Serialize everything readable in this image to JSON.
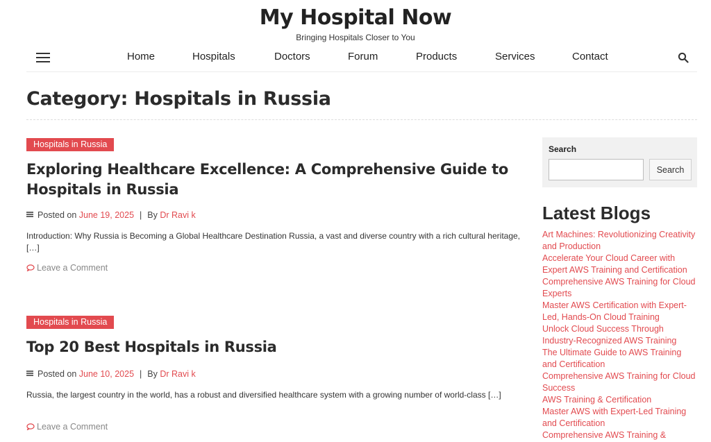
{
  "header": {
    "site_title": "My Hospital Now",
    "tagline": "Bringing Hospitals Closer to You"
  },
  "nav": {
    "items": [
      {
        "label": "Home"
      },
      {
        "label": "Hospitals"
      },
      {
        "label": "Doctors"
      },
      {
        "label": "Forum"
      },
      {
        "label": "Products"
      },
      {
        "label": "Services"
      },
      {
        "label": "Contact"
      }
    ]
  },
  "archive": {
    "title": "Category: Hospitals in Russia"
  },
  "posts": [
    {
      "category": "Hospitals in Russia",
      "title": "Exploring Healthcare Excellence: A Comprehensive Guide to Hospitals in Russia",
      "posted_on_label": "Posted on",
      "date": "June 19, 2025",
      "separator": "|",
      "by_label": "By",
      "author": "Dr Ravi k",
      "excerpt": "Introduction: Why Russia is Becoming a Global Healthcare Destination Russia, a vast and diverse country with a rich cultural heritage, […]",
      "comment_link": "Leave a Comment"
    },
    {
      "category": "Hospitals in Russia",
      "title": "Top 20 Best Hospitals in Russia",
      "posted_on_label": "Posted on",
      "date": "June 10, 2025",
      "separator": "|",
      "by_label": "By",
      "author": "Dr Ravi k",
      "excerpt": "Russia, the largest country in the world, has a robust and diversified healthcare system with a growing number of world-class […]",
      "comment_link": "Leave a Comment"
    }
  ],
  "sidebar": {
    "search": {
      "label": "Search",
      "placeholder": "",
      "button_label": "Search"
    },
    "latest_blogs": {
      "title": "Latest Blogs",
      "items": [
        "Art Machines: Revolutionizing Creativity and Production",
        "Accelerate Your Cloud Career with Expert AWS Training and Certification",
        "Comprehensive AWS Training for Cloud Experts",
        "Master AWS Certification with Expert-Led, Hands-On Cloud Training",
        "Unlock Cloud Success Through Industry-Recognized AWS Training",
        "The Ultimate Guide to AWS Training and Certification",
        "Comprehensive AWS Training for Cloud Success",
        "AWS Training & Certification",
        "Master AWS with Expert-Led Training and Certification",
        "Comprehensive AWS Training &"
      ]
    }
  },
  "colors": {
    "accent": "#e24a4f",
    "text": "#2b2b2b",
    "widget_bg": "#f1f1f1"
  }
}
